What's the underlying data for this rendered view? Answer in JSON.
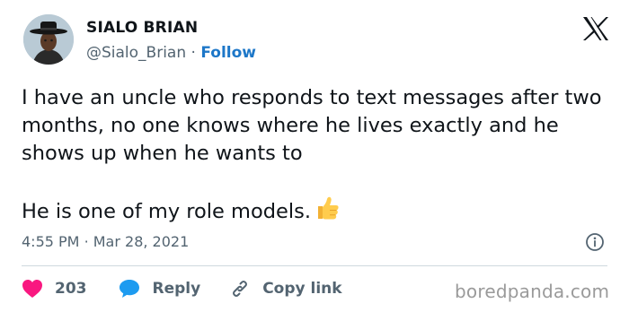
{
  "author": {
    "display_name": "SIALO BRIAN",
    "handle": "@Sialo_Brian",
    "separator": "·",
    "follow_label": "Follow"
  },
  "tweet": {
    "paragraph_1": "I have an uncle who responds to text messages after two months, no one knows where he lives exactly and he shows up when he wants to",
    "paragraph_2": "He is one of my role models.",
    "emoji_icon": "thumbs-up-icon"
  },
  "meta": {
    "time": "4:55 PM",
    "date": "Mar 28, 2021",
    "separator": "·"
  },
  "actions": {
    "like_count": "203",
    "reply_label": "Reply",
    "copy_link_label": "Copy link"
  },
  "watermark": "boredpanda.com",
  "colors": {
    "follow": "#1d77c8",
    "heart": "#f91880",
    "reply_bubble": "#1d9bf0",
    "secondary_text": "#536471",
    "divider": "#cfd9de"
  },
  "icons": [
    "x-logo-icon",
    "info-icon",
    "heart-icon",
    "reply-bubble-icon",
    "link-icon",
    "thumbs-up-icon"
  ]
}
